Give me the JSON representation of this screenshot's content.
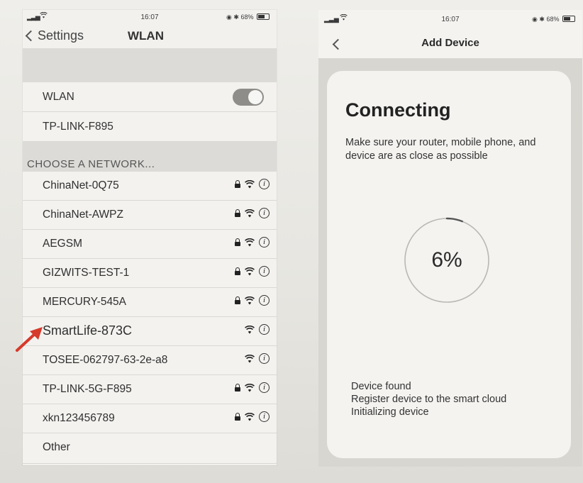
{
  "left_phone": {
    "status": {
      "time": "16:07",
      "battery": "68%"
    },
    "nav": {
      "back_label": "Settings",
      "title": "WLAN"
    },
    "wlan_row": {
      "label": "WLAN",
      "toggle": "on"
    },
    "connected_network": "TP-LINK-F895",
    "section_header": "CHOOSE A NETWORK...",
    "networks": [
      {
        "name": "ChinaNet-0Q75",
        "locked": true
      },
      {
        "name": "ChinaNet-AWPZ",
        "locked": true
      },
      {
        "name": "AEGSM",
        "locked": true
      },
      {
        "name": "GIZWITS-TEST-1",
        "locked": true
      },
      {
        "name": "MERCURY-545A",
        "locked": true
      },
      {
        "name": "SmartLife-873C",
        "locked": false
      },
      {
        "name": "TOSEE-062797-63-2e-a8",
        "locked": false
      },
      {
        "name": "TP-LINK-5G-F895",
        "locked": true
      },
      {
        "name": "xkn123456789",
        "locked": true
      }
    ],
    "other_label": "Other"
  },
  "right_phone": {
    "status": {
      "time": "16:07",
      "battery": "68%"
    },
    "nav": {
      "title": "Add Device"
    },
    "heading": "Connecting",
    "description": "Make sure your router, mobile phone, and device are as close as possible",
    "progress_text": "6%",
    "progress_value": 6,
    "steps": [
      "Device found",
      "Register device to the smart cloud",
      "Initializing device"
    ]
  },
  "colors": {
    "arrow": "#d63a2a",
    "toggle": "#8e8d89"
  }
}
